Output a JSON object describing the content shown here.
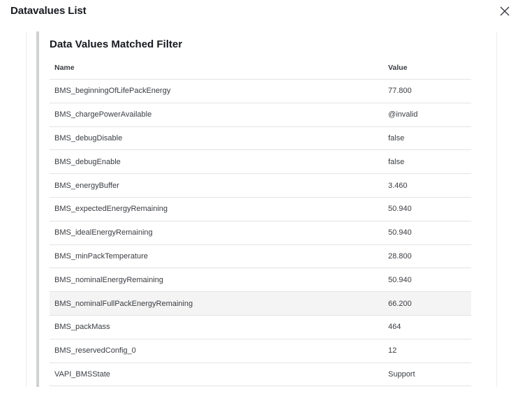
{
  "dialog": {
    "title": "Datavalues List"
  },
  "panel": {
    "heading": "Data Values Matched Filter"
  },
  "table": {
    "columns": [
      "Name",
      "Value"
    ],
    "rows": [
      {
        "name": "BMS_beginningOfLifePackEnergy",
        "value": "77.800"
      },
      {
        "name": "BMS_chargePowerAvailable",
        "value": "@invalid"
      },
      {
        "name": "BMS_debugDisable",
        "value": "false"
      },
      {
        "name": "BMS_debugEnable",
        "value": "false"
      },
      {
        "name": "BMS_energyBuffer",
        "value": "3.460"
      },
      {
        "name": "BMS_expectedEnergyRemaining",
        "value": "50.940"
      },
      {
        "name": "BMS_idealEnergyRemaining",
        "value": "50.940"
      },
      {
        "name": "BMS_minPackTemperature",
        "value": "28.800"
      },
      {
        "name": "BMS_nominalEnergyRemaining",
        "value": "50.940"
      },
      {
        "name": "BMS_nominalFullPackEnergyRemaining",
        "value": "66.200"
      },
      {
        "name": "BMS_packMass",
        "value": "464"
      },
      {
        "name": "BMS_reservedConfig_0",
        "value": "12"
      },
      {
        "name": "VAPI_BMSState",
        "value": "Support"
      }
    ]
  },
  "icons": {
    "close": "close-icon"
  }
}
